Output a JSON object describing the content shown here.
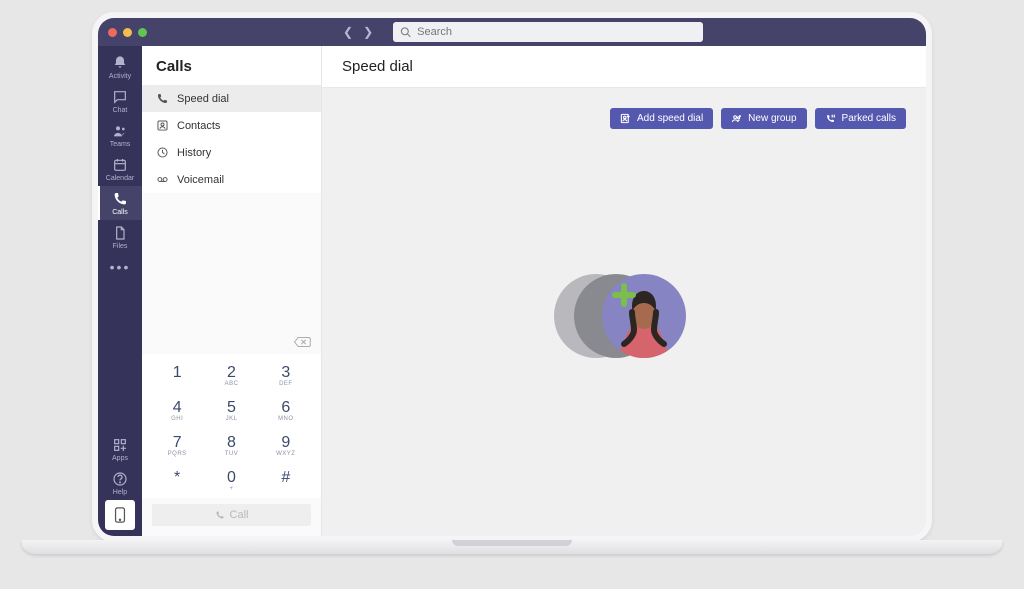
{
  "search": {
    "placeholder": "Search"
  },
  "rail": {
    "items": [
      {
        "label": "Activity"
      },
      {
        "label": "Chat"
      },
      {
        "label": "Teams"
      },
      {
        "label": "Calendar"
      },
      {
        "label": "Calls"
      },
      {
        "label": "Files"
      }
    ],
    "apps_label": "Apps",
    "help_label": "Help"
  },
  "calls": {
    "header": "Calls",
    "nav": {
      "speed_dial": "Speed dial",
      "contacts": "Contacts",
      "history": "History",
      "voicemail": "Voicemail"
    },
    "dialpad": [
      {
        "d": "1",
        "l": ""
      },
      {
        "d": "2",
        "l": "ABC"
      },
      {
        "d": "3",
        "l": "DEF"
      },
      {
        "d": "4",
        "l": "GHI"
      },
      {
        "d": "5",
        "l": "JKL"
      },
      {
        "d": "6",
        "l": "MNO"
      },
      {
        "d": "7",
        "l": "PQRS"
      },
      {
        "d": "8",
        "l": "TUV"
      },
      {
        "d": "9",
        "l": "WXYZ"
      },
      {
        "d": "*",
        "l": ""
      },
      {
        "d": "0",
        "l": "+"
      },
      {
        "d": "#",
        "l": ""
      }
    ],
    "call_button": "Call"
  },
  "main": {
    "title": "Speed dial",
    "actions": {
      "add_speed_dial": "Add speed dial",
      "new_group": "New group",
      "parked_calls": "Parked calls"
    }
  }
}
